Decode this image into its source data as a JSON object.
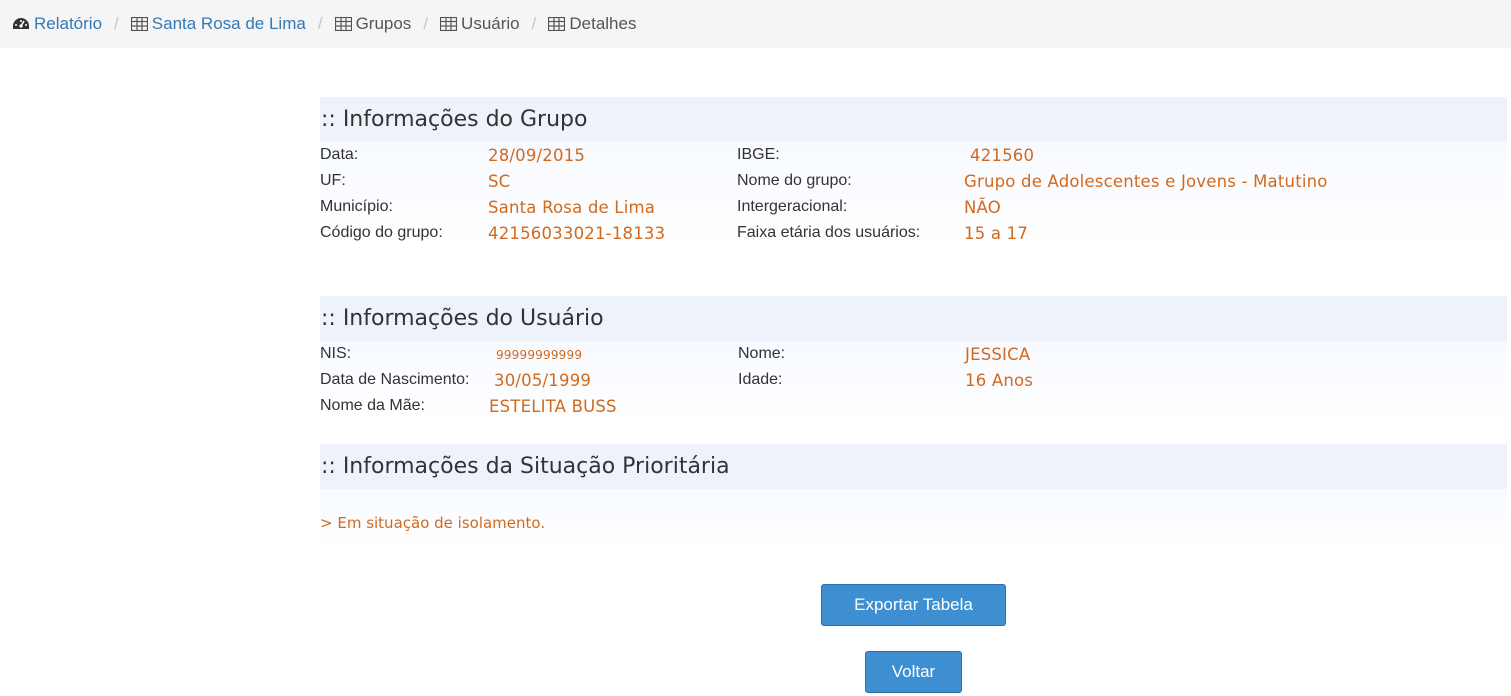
{
  "breadcrumb": {
    "items": [
      {
        "label": "Relatório",
        "icon": "dashboard-icon",
        "link": true
      },
      {
        "label": "Santa Rosa de Lima",
        "icon": "table-icon",
        "link": true
      },
      {
        "label": "Grupos",
        "icon": "table-icon",
        "link": false
      },
      {
        "label": "Usuário",
        "icon": "table-icon",
        "link": false
      },
      {
        "label": "Detalhes",
        "icon": "table-icon",
        "link": false
      }
    ],
    "separator": "/"
  },
  "grupo": {
    "title": ":: Informações do Grupo",
    "data_label": "Data:",
    "data_value": "28/09/2015",
    "uf_label": "UF:",
    "uf_value": "SC",
    "municipio_label": "Município:",
    "municipio_value": "Santa Rosa de Lima",
    "codigo_label": "Código do grupo:",
    "codigo_value": "42156033021-18133",
    "ibge_label": "IBGE:",
    "ibge_value": "421560",
    "nome_label": "Nome do grupo:",
    "nome_value": "Grupo de Adolescentes e Jovens - Matutino",
    "intergeracional_label": "Intergeracional:",
    "intergeracional_value": "NÃO",
    "faixa_label": "Faixa etária dos usuários:",
    "faixa_value": "15 a 17"
  },
  "usuario": {
    "title": ":: Informações do Usuário",
    "nis_label": "NIS:",
    "nis_value": "99999999999",
    "nascimento_label": "Data de Nascimento:",
    "nascimento_value": "30/05/1999",
    "mae_label": "Nome da Mãe:",
    "mae_value": "ESTELITA BUSS",
    "nome_label": "Nome:",
    "nome_value": "JESSICA",
    "idade_label": "Idade:",
    "idade_value": "16 Anos"
  },
  "situacao": {
    "title": ":: Informações da Situação Prioritária",
    "item": "> Em situação de isolamento."
  },
  "actions": {
    "export_label": "Exportar Tabela",
    "back_label": "Voltar"
  },
  "colors": {
    "link": "#3379b7",
    "value": "#d2691e",
    "section_bg": "#eef3fb",
    "button": "#3d8fd1"
  }
}
